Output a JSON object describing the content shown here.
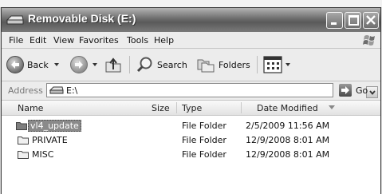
{
  "window": {
    "title": "Removable Disk (E:)"
  },
  "menu": {
    "file": "File",
    "edit": "Edit",
    "view": "View",
    "favorites": "Favorites",
    "tools": "Tools",
    "help": "Help"
  },
  "toolbar": {
    "back_label": "Back",
    "search_label": "Search",
    "folders_label": "Folders"
  },
  "address": {
    "label": "Address",
    "value": "E:\\",
    "go_label": "Go"
  },
  "columns": {
    "name": "Name",
    "size": "Size",
    "type": "Type",
    "date_modified": "Date Modified"
  },
  "files": [
    {
      "name": "vl4_update",
      "size": "",
      "type": "File Folder",
      "date_modified": "2/5/2009 11:56 AM",
      "selected": true
    },
    {
      "name": "PRIVATE",
      "size": "",
      "type": "File Folder",
      "date_modified": "12/9/2008 8:01 AM",
      "selected": false
    },
    {
      "name": "MISC",
      "size": "",
      "type": "File Folder",
      "date_modified": "12/9/2008 8:01 AM",
      "selected": false
    }
  ],
  "icons": {
    "title": "drive-icon",
    "back": "back-arrow-icon",
    "forward": "forward-arrow-icon",
    "up": "folder-up-icon",
    "search": "magnifier-icon",
    "folders": "folders-icon",
    "views": "views-icon",
    "go": "go-arrow-icon",
    "file_rows": "folder-icon"
  },
  "colors": {
    "title_bar": "#6c6c6c",
    "selection": "#8a8a8a"
  }
}
